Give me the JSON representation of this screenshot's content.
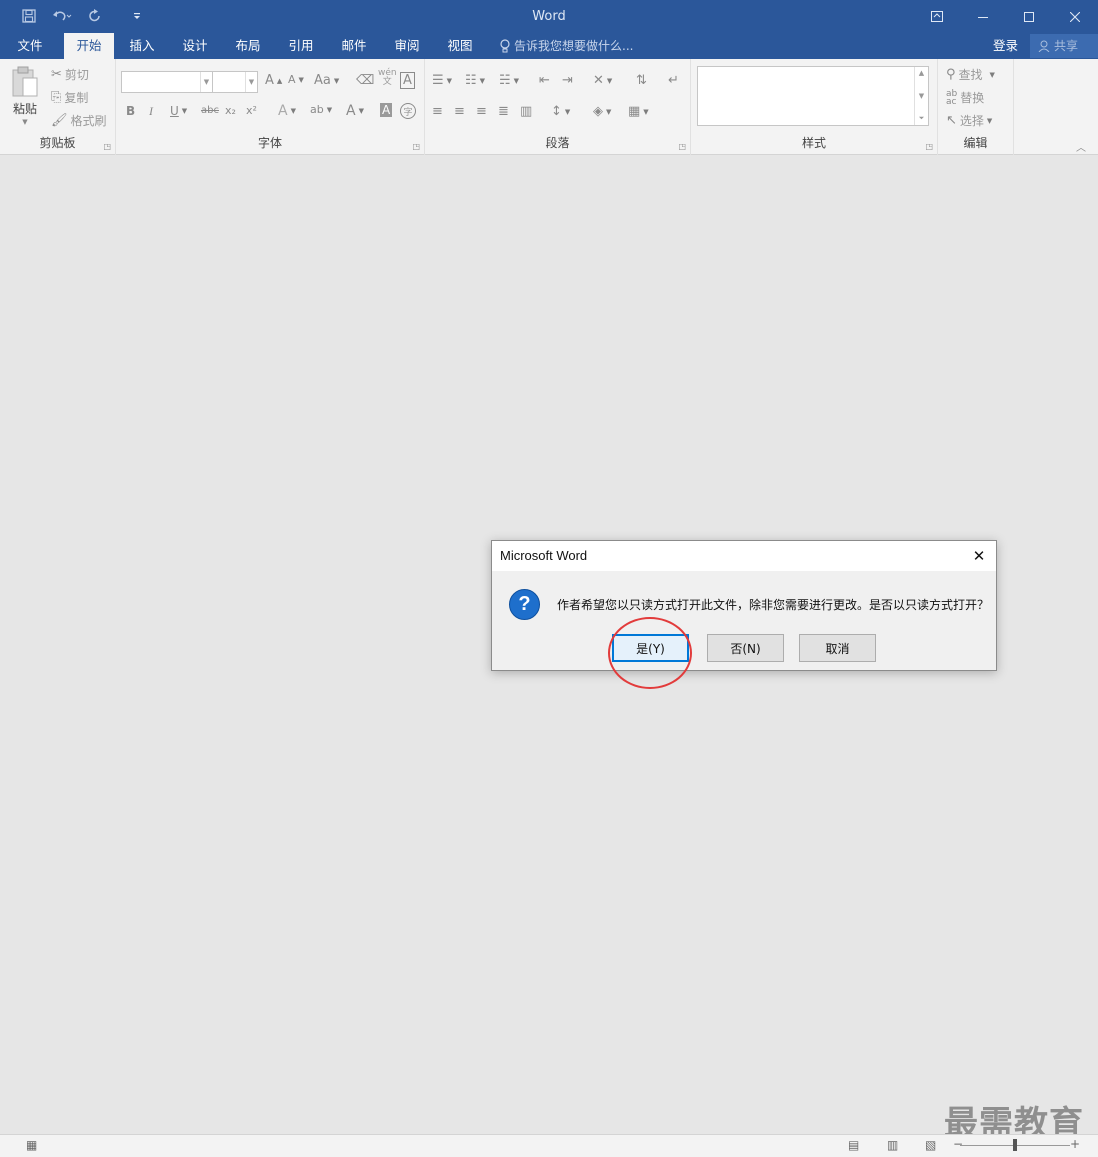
{
  "titlebar": {
    "title": "Word",
    "qat": {
      "save_icon": "save-icon",
      "undo_icon": "undo-icon",
      "redo_icon": "redo-icon",
      "customize_icon": "customize-qat-icon"
    }
  },
  "tabs": [
    {
      "label": "文件",
      "active": false
    },
    {
      "label": "开始",
      "active": true
    },
    {
      "label": "插入",
      "active": false
    },
    {
      "label": "设计",
      "active": false
    },
    {
      "label": "布局",
      "active": false
    },
    {
      "label": "引用",
      "active": false
    },
    {
      "label": "邮件",
      "active": false
    },
    {
      "label": "审阅",
      "active": false
    },
    {
      "label": "视图",
      "active": false
    }
  ],
  "tellme": "告诉我您想要做什么...",
  "account": {
    "login": "登录",
    "share": "共享"
  },
  "ribbon": {
    "clipboard": {
      "label": "剪贴板",
      "paste": "粘贴",
      "cut": "剪切",
      "copy": "复制",
      "format_painter": "格式刷"
    },
    "font": {
      "label": "字体",
      "bold": "B",
      "italic": "I",
      "underline": "U",
      "strike": "abc",
      "sub": "x₂",
      "sup": "x²",
      "grow": "A",
      "shrink": "A",
      "case": "Aa",
      "pinyin_top": "wén",
      "pinyin_bottom": "文",
      "border_char": "A",
      "effects": "A",
      "highlight": "ab",
      "color": "A",
      "shading": "A",
      "enclose": "字"
    },
    "paragraph": {
      "label": "段落"
    },
    "styles": {
      "label": "样式"
    },
    "editing": {
      "label": "编辑",
      "find": "查找",
      "replace": "替换",
      "select": "选择"
    }
  },
  "dialog": {
    "title": "Microsoft Word",
    "message": "作者希望您以只读方式打开此文件，除非您需要进行更改。是否以只读方式打开？",
    "yes": "是(Y)",
    "no": "否(N)",
    "cancel": "取消"
  },
  "watermark": "最需教育",
  "colors": {
    "brand": "#2b579a",
    "accent": "#0078d7",
    "highlight_circle": "#e23b3b"
  }
}
